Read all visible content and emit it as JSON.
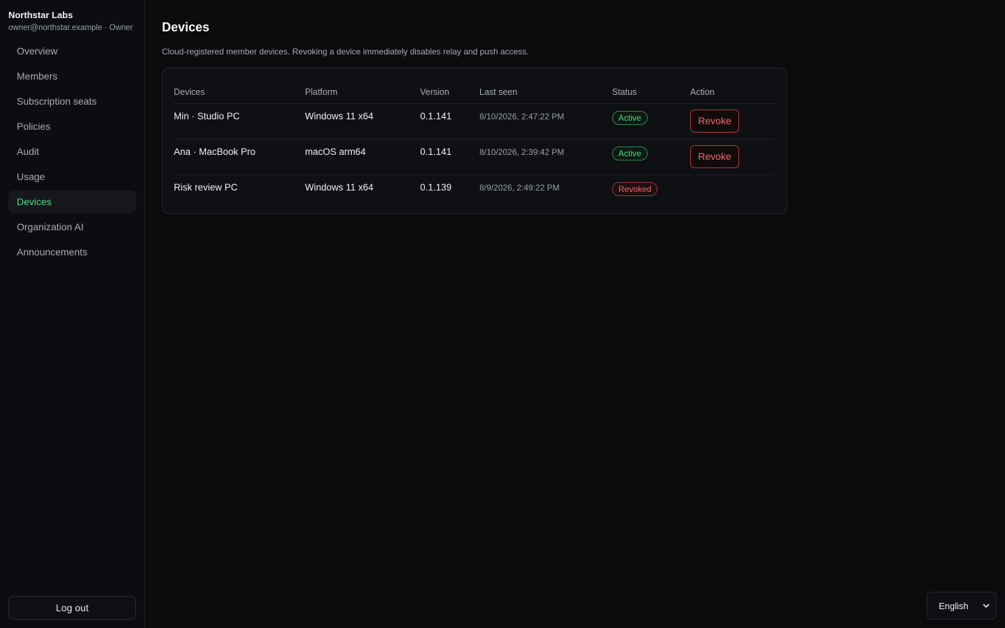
{
  "sidebar": {
    "org_name": "Northstar Labs",
    "org_sub": "owner@northstar.example · Owner",
    "items": [
      {
        "label": "Overview",
        "active": false
      },
      {
        "label": "Members",
        "active": false
      },
      {
        "label": "Subscription seats",
        "active": false
      },
      {
        "label": "Policies",
        "active": false
      },
      {
        "label": "Audit",
        "active": false
      },
      {
        "label": "Usage",
        "active": false
      },
      {
        "label": "Devices",
        "active": true
      },
      {
        "label": "Organization AI",
        "active": false
      },
      {
        "label": "Announcements",
        "active": false
      }
    ],
    "logout_label": "Log out"
  },
  "page": {
    "title": "Devices",
    "description": "Cloud-registered member devices. Revoking a device immediately disables relay and push access."
  },
  "table": {
    "headers": {
      "device": "Devices",
      "platform": "Platform",
      "version": "Version",
      "last_seen": "Last seen",
      "status": "Status",
      "action": "Action"
    },
    "rows": [
      {
        "device": "Min · Studio PC",
        "platform": "Windows 11 x64",
        "version": "0.1.141",
        "last_seen": "8/10/2026, 2:47:22 PM",
        "status": "Active",
        "action": "Revoke"
      },
      {
        "device": "Ana · MacBook Pro",
        "platform": "macOS arm64",
        "version": "0.1.141",
        "last_seen": "8/10/2026, 2:39:42 PM",
        "status": "Active",
        "action": "Revoke"
      },
      {
        "device": "Risk review PC",
        "platform": "Windows 11 x64",
        "version": "0.1.139",
        "last_seen": "8/9/2026, 2:49:22 PM",
        "status": "Revoked",
        "action": ""
      }
    ]
  },
  "language": {
    "selected": "English",
    "icon": "chevron-down-icon"
  },
  "colors": {
    "accent": "#4ade80",
    "danger": "#f26a6f",
    "background": "#0a0b0d"
  }
}
